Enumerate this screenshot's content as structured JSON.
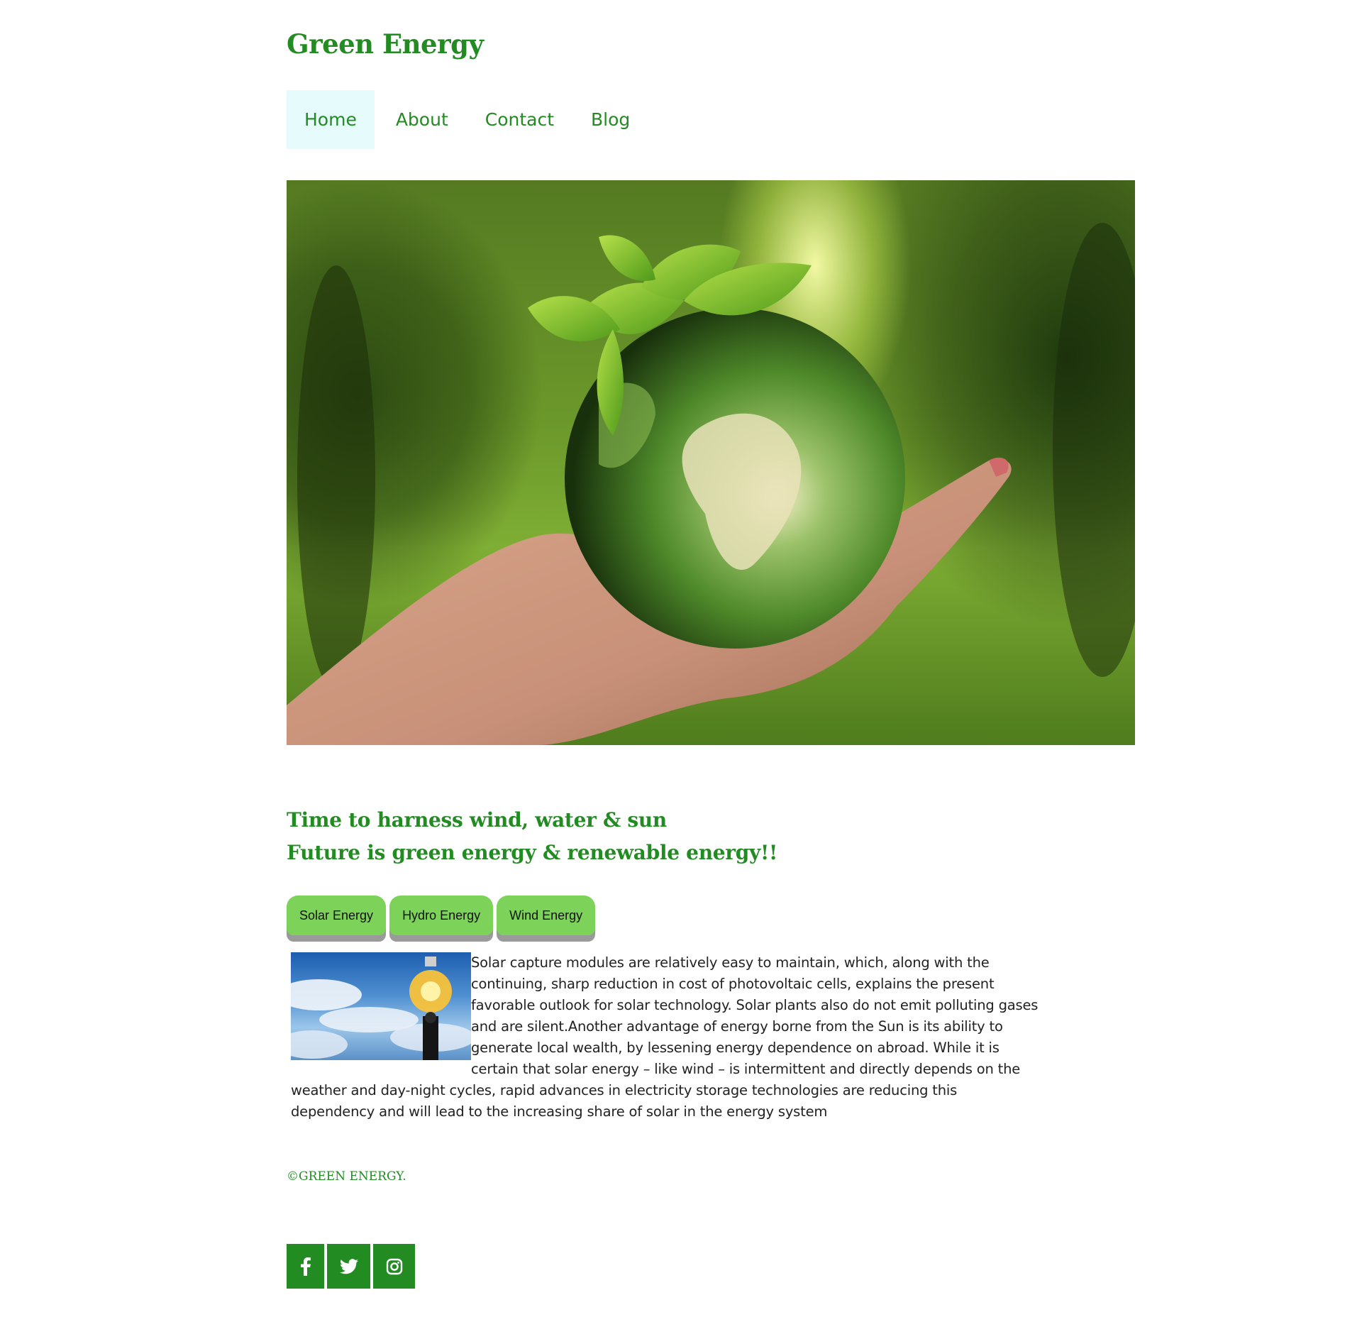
{
  "site": {
    "title": "Green Energy"
  },
  "nav": {
    "items": [
      {
        "label": "Home",
        "active": true
      },
      {
        "label": "About",
        "active": false
      },
      {
        "label": "Contact",
        "active": false
      },
      {
        "label": "Blog",
        "active": false
      }
    ]
  },
  "hero": {
    "image": "hand-holding-green-globe-with-leaves"
  },
  "tagline": {
    "line1": "Time to harness wind, water & sun",
    "line2": "Future is green energy & renewable energy!!"
  },
  "tabs": [
    {
      "label": "Solar Energy"
    },
    {
      "label": "Hydro Energy"
    },
    {
      "label": "Wind Energy"
    }
  ],
  "content": {
    "image": "man-holding-light-bulb-sky",
    "text": "Solar capture modules are relatively easy to maintain, which, along with the continuing, sharp reduction in cost of photovoltaic cells, explains the present favorable outlook for solar technology. Solar plants also do not emit polluting gases and are silent.Another advantage of energy borne from the Sun is its ability to generate local wealth, by lessening energy dependence on abroad. While it is certain that solar energy – like wind – is intermittent and directly depends on the weather and day-night cycles, rapid advances in electricity storage technologies are reducing this dependency and will lead to the increasing share of solar in the energy system"
  },
  "footer": {
    "copyright": "©GREEN ENERGY."
  },
  "social": [
    "facebook-icon",
    "twitter-icon",
    "instagram-icon"
  ],
  "colors": {
    "brand": "#228b22",
    "nav_active_bg": "#e6fbfb",
    "tab_bg": "#7dd35a"
  }
}
